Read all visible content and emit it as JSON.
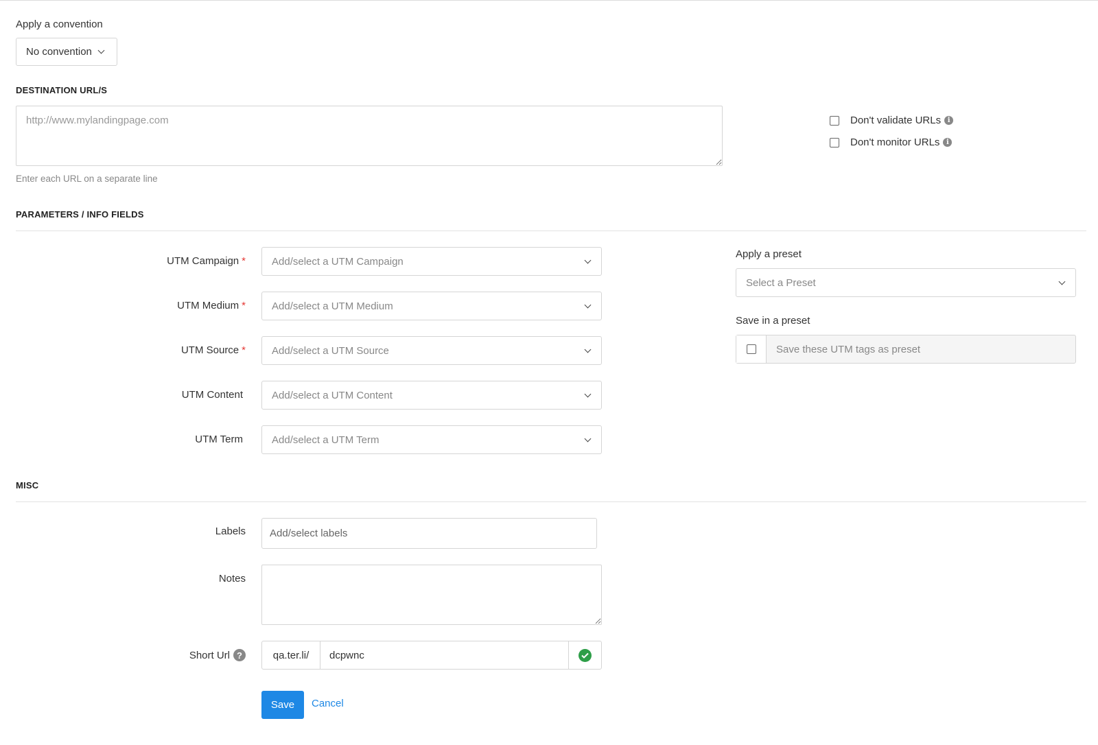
{
  "convention": {
    "label": "Apply a convention",
    "button": "No convention"
  },
  "destination": {
    "title": "DESTINATION URL/S",
    "placeholder": "http://www.mylandingpage.com",
    "help": "Enter each URL on a separate line",
    "options": [
      {
        "label": "Don't validate URLs",
        "checked": false
      },
      {
        "label": "Don't monitor URLs",
        "checked": false
      }
    ]
  },
  "params": {
    "title": "PARAMETERS / INFO FIELDS",
    "fields": [
      {
        "label": "UTM Campaign",
        "required": "*",
        "placeholder": "Add/select a UTM Campaign"
      },
      {
        "label": "UTM Medium",
        "required": "*",
        "placeholder": "Add/select a UTM Medium"
      },
      {
        "label": "UTM Source",
        "required": "*",
        "placeholder": "Add/select a UTM Source"
      },
      {
        "label": "UTM Content",
        "required": "",
        "placeholder": "Add/select a UTM Content"
      },
      {
        "label": "UTM Term",
        "required": "",
        "placeholder": "Add/select a UTM Term"
      }
    ]
  },
  "preset": {
    "apply_label": "Apply a preset",
    "select_placeholder": "Select a Preset",
    "save_label": "Save in a preset",
    "save_placeholder": "Save these UTM tags as preset",
    "save_checked": false
  },
  "misc": {
    "title": "MISC",
    "labels_label": "Labels",
    "labels_placeholder": "Add/select labels",
    "notes_label": "Notes",
    "short_url_label": "Short Url",
    "short_url_prefix": "qa.ter.li/",
    "short_url_value": "dcpwnc",
    "question_mark": "?",
    "info_mark": "i"
  },
  "actions": {
    "save": "Save",
    "cancel": "Cancel"
  },
  "colors": {
    "primary": "#1e88e5",
    "required": "#e53935",
    "success": "#2e9e48"
  }
}
